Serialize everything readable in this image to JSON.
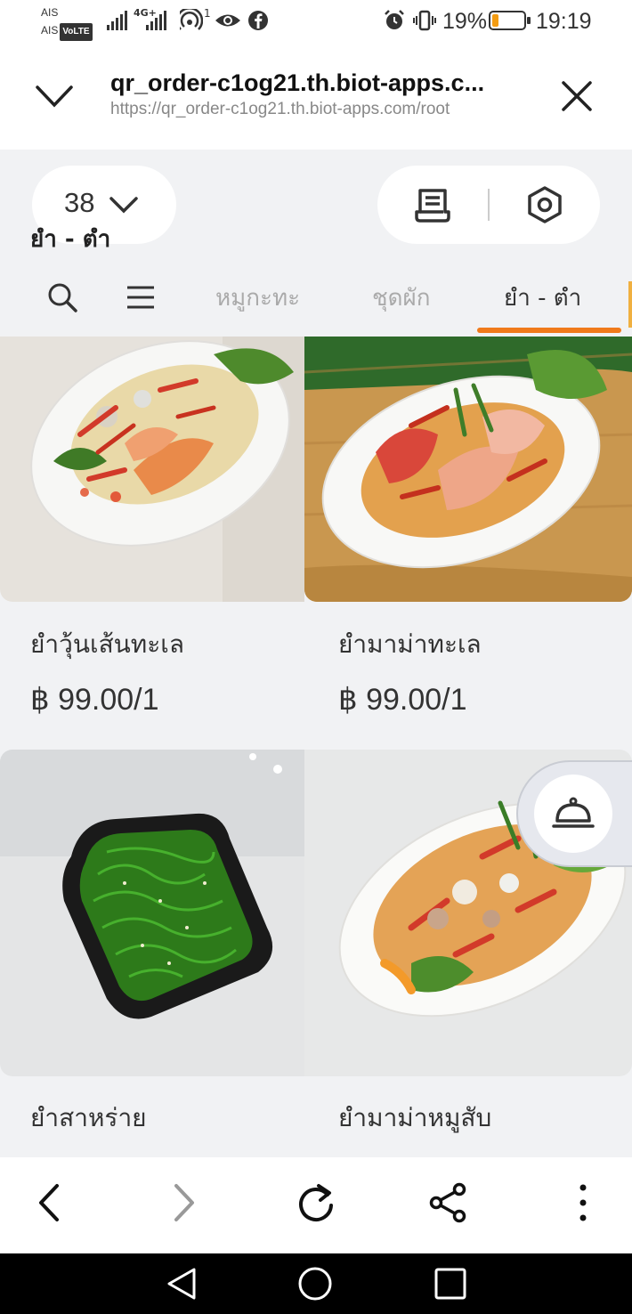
{
  "status_bar": {
    "carrier_1": "AIS",
    "carrier_2": "AIS",
    "volte": "VoLTE",
    "network": "4G+",
    "hotspot_count": "1",
    "battery_percent": "19%",
    "battery_level": 0.19,
    "time": "19:19",
    "battery_color": "#f39c12"
  },
  "browser": {
    "page_title": "qr_order-c1og21.th.biot-apps.c...",
    "url": "https://qr_order-c1og21.th.biot-apps.com/root",
    "icons": [
      "chevron-down-icon",
      "close-icon"
    ]
  },
  "header": {
    "table_number": "38",
    "current_section": "ยำ - ตำ",
    "icons": [
      "chevron-down-icon",
      "receipt-icon",
      "settings-icon"
    ]
  },
  "category_tabs": {
    "items": [
      {
        "label": "หมูกะทะ",
        "active": false
      },
      {
        "label": "ชุดผัก",
        "active": false
      },
      {
        "label": "ยำ - ตำ",
        "active": true
      }
    ],
    "accent_color": "#f07a1a"
  },
  "menu_items": [
    {
      "name": "ยำวุ้นเส้นทะเล",
      "price": "฿ 99.00/1"
    },
    {
      "name": "ยำมาม่าทะเล",
      "price": "฿ 99.00/1"
    },
    {
      "name": "ยำสาหร่าย",
      "price": ""
    },
    {
      "name": "ยำมาม่าหมูสับ",
      "price": ""
    }
  ],
  "floating_button": {
    "icon": "call-waiter-bell-icon"
  },
  "toolbar": {
    "icons": [
      "back-icon",
      "forward-icon",
      "reload-icon",
      "share-icon",
      "more-icon"
    ]
  },
  "nav_bar": {
    "icons": [
      "nav-back-icon",
      "nav-home-icon",
      "nav-recents-icon"
    ]
  }
}
